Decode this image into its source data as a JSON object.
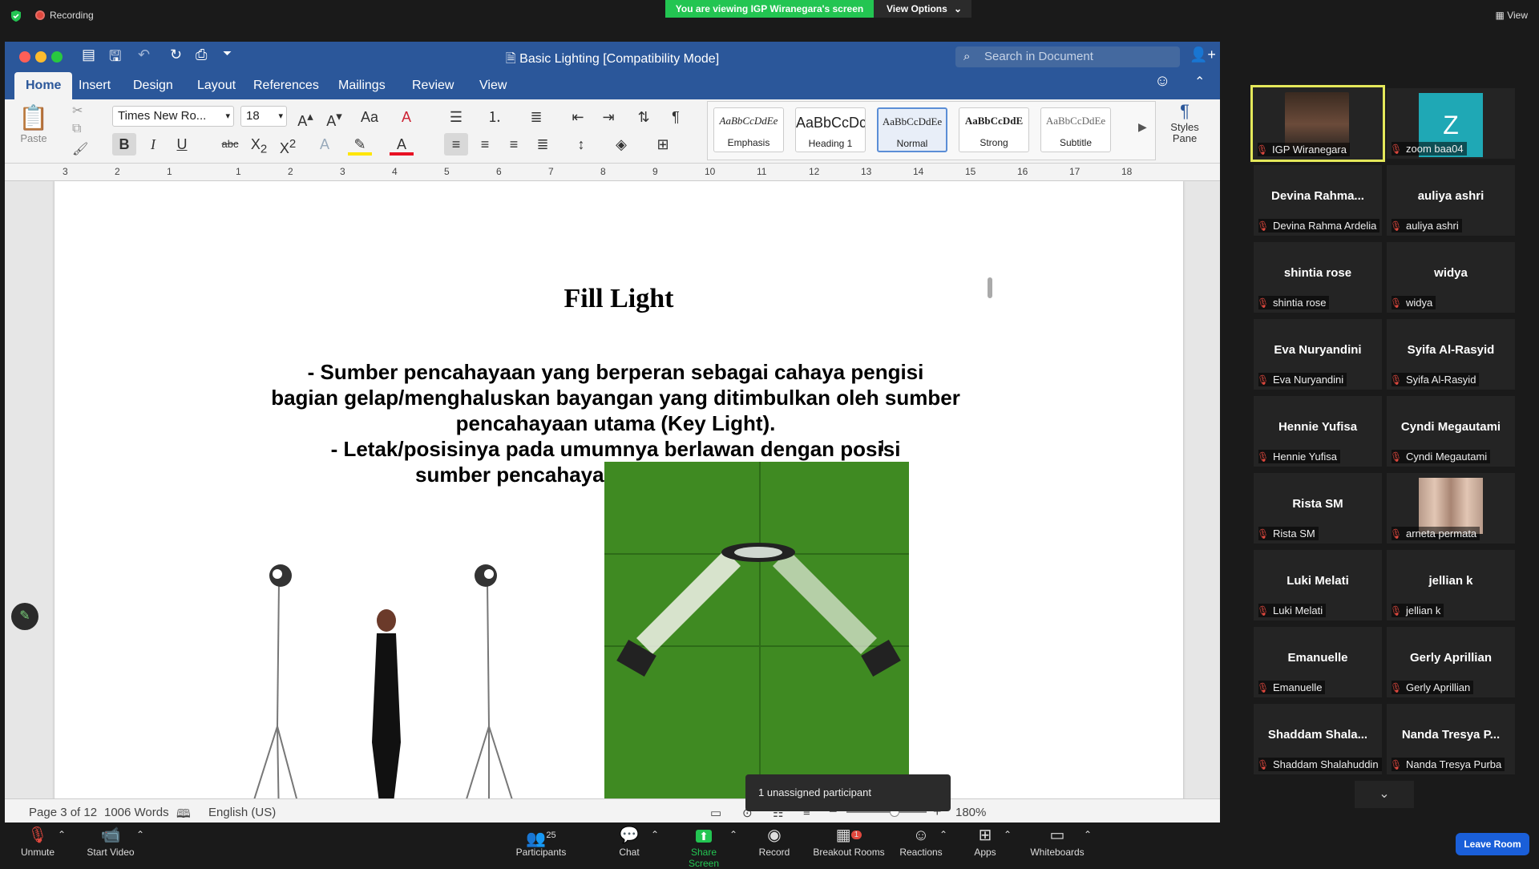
{
  "zoom_top": {
    "recording_label": "Recording",
    "viewing_banner": "You are viewing IGP Wiranegara's screen",
    "view_options": "View Options",
    "view_label": "View"
  },
  "word": {
    "title": "Basic Lighting [Compatibility Mode]",
    "search_placeholder": "Search in Document",
    "tabs": [
      "Home",
      "Insert",
      "Design",
      "Layout",
      "References",
      "Mailings",
      "Review",
      "View"
    ],
    "font_name": "Times New Ro...",
    "font_size": "18",
    "paste_label": "Paste",
    "styles": [
      {
        "preview": "AaBbCcDdEe",
        "name": "Emphasis"
      },
      {
        "preview": "AaBbCcDc",
        "name": "Heading 1"
      },
      {
        "preview": "AaBbCcDdEe",
        "name": "Normal"
      },
      {
        "preview": "AaBbCcDdE",
        "name": "Strong"
      },
      {
        "preview": "AaBbCcDdEe",
        "name": "Subtitle"
      }
    ],
    "styles_pane": "Styles Pane",
    "ruler_numbers": [
      "3",
      "2",
      "1",
      "1",
      "2",
      "3",
      "4",
      "5",
      "6",
      "7",
      "8",
      "9",
      "10",
      "11",
      "12",
      "13",
      "14",
      "15",
      "16",
      "17",
      "18"
    ],
    "document": {
      "heading": "Fill Light",
      "lines": [
        "- Sumber pencahayaan yang berperan sebagai cahaya pengisi",
        "bagian gelap/menghaluskan bayangan yang ditimbulkan oleh sumber",
        "pencahayaan utama (Key Light).",
        "- Letak/posisinya pada umumnya berlawan dengan posisi",
        "sumber pencahayaan utama (Key Light)."
      ]
    },
    "status": {
      "page": "Page 3 of 12",
      "words": "1006 Words",
      "language": "English (US)",
      "zoom": "180%"
    }
  },
  "tooltip": "1 unassigned participant",
  "participants": [
    {
      "big": "",
      "small": "IGP Wiranegara",
      "video": true,
      "highlight": true
    },
    {
      "big": "Z",
      "small": "zoom baa04",
      "avatar": true
    },
    {
      "big": "Devina  Rahma...",
      "small": "Devina Rahma Ardelia"
    },
    {
      "big": "auliya ashri",
      "small": "auliya ashri"
    },
    {
      "big": "shintia rose",
      "small": "shintia rose"
    },
    {
      "big": "widya",
      "small": "widya"
    },
    {
      "big": "Eva Nuryandini",
      "small": "Eva Nuryandini"
    },
    {
      "big": "Syifa Al-Rasyid",
      "small": "Syifa Al-Rasyid"
    },
    {
      "big": "Hennie Yufisa",
      "small": "Hennie Yufisa"
    },
    {
      "big": "Cyndi Megautami",
      "small": "Cyndi Megautami"
    },
    {
      "big": "Rista SM",
      "small": "Rista SM"
    },
    {
      "big": "",
      "small": "arneta permata",
      "photo": true
    },
    {
      "big": "Luki Melati",
      "small": "Luki Melati"
    },
    {
      "big": "jellian k",
      "small": "jellian k"
    },
    {
      "big": "Emanuelle",
      "small": "Emanuelle"
    },
    {
      "big": "Gerly Aprillian",
      "small": "Gerly Aprillian"
    },
    {
      "big": "Shaddam  Shala...",
      "small": "Shaddam Shalahuddin"
    },
    {
      "big": "Nanda Tresya P...",
      "small": "Nanda Tresya Purba"
    }
  ],
  "toolbar": {
    "unmute": "Unmute",
    "start_video": "Start Video",
    "participants": "Participants",
    "participants_count": "25",
    "chat": "Chat",
    "share_screen": "Share Screen",
    "record": "Record",
    "breakout_rooms": "Breakout Rooms",
    "breakout_badge": "1",
    "reactions": "Reactions",
    "apps": "Apps",
    "whiteboards": "Whiteboards",
    "leave_room": "Leave Room"
  }
}
